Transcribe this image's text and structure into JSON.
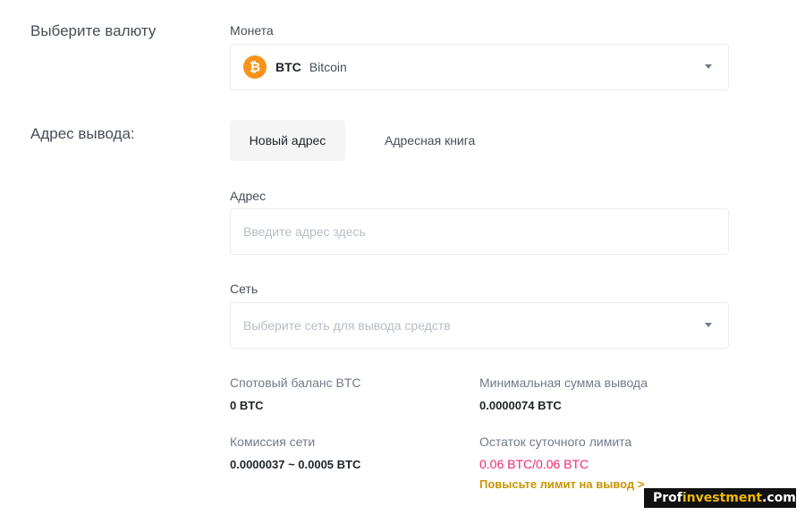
{
  "currency_section": {
    "label": "Выберите валюту",
    "coin_label": "Монета",
    "coin": {
      "icon": "bitcoin-icon",
      "icon_glyph": "₿",
      "symbol": "BTC",
      "name": "Bitcoin"
    }
  },
  "address_section": {
    "label": "Адрес вывода:",
    "tabs": [
      {
        "label": "Новый адрес",
        "active": true
      },
      {
        "label": "Адресная книга",
        "active": false
      }
    ],
    "address_label": "Адрес",
    "address_placeholder": "Введите адрес здесь",
    "network_label": "Сеть",
    "network_placeholder": "Выберите сеть для вывода средств"
  },
  "stats": {
    "spot_balance_label": "Спотовый баланс BTC",
    "spot_balance_value": "0 BTC",
    "min_withdraw_label": "Минимальная сумма вывода",
    "min_withdraw_value": "0.0000074 BTC",
    "network_fee_label": "Комиссия сети",
    "network_fee_value": "0.0000037 ~ 0.0005 BTC",
    "daily_limit_label": "Остаток суточного лимита",
    "daily_limit_value": "0.06 BTC/0.06 BTC",
    "raise_limit_link": "Повысьте лимит на вывод >"
  },
  "watermark": {
    "brand_a": "Prof",
    "brand_b": "investment",
    "brand_c": ".com"
  },
  "colors": {
    "bitcoin": "#f7931a",
    "pink": "#f0286e",
    "gold": "#c99400"
  }
}
